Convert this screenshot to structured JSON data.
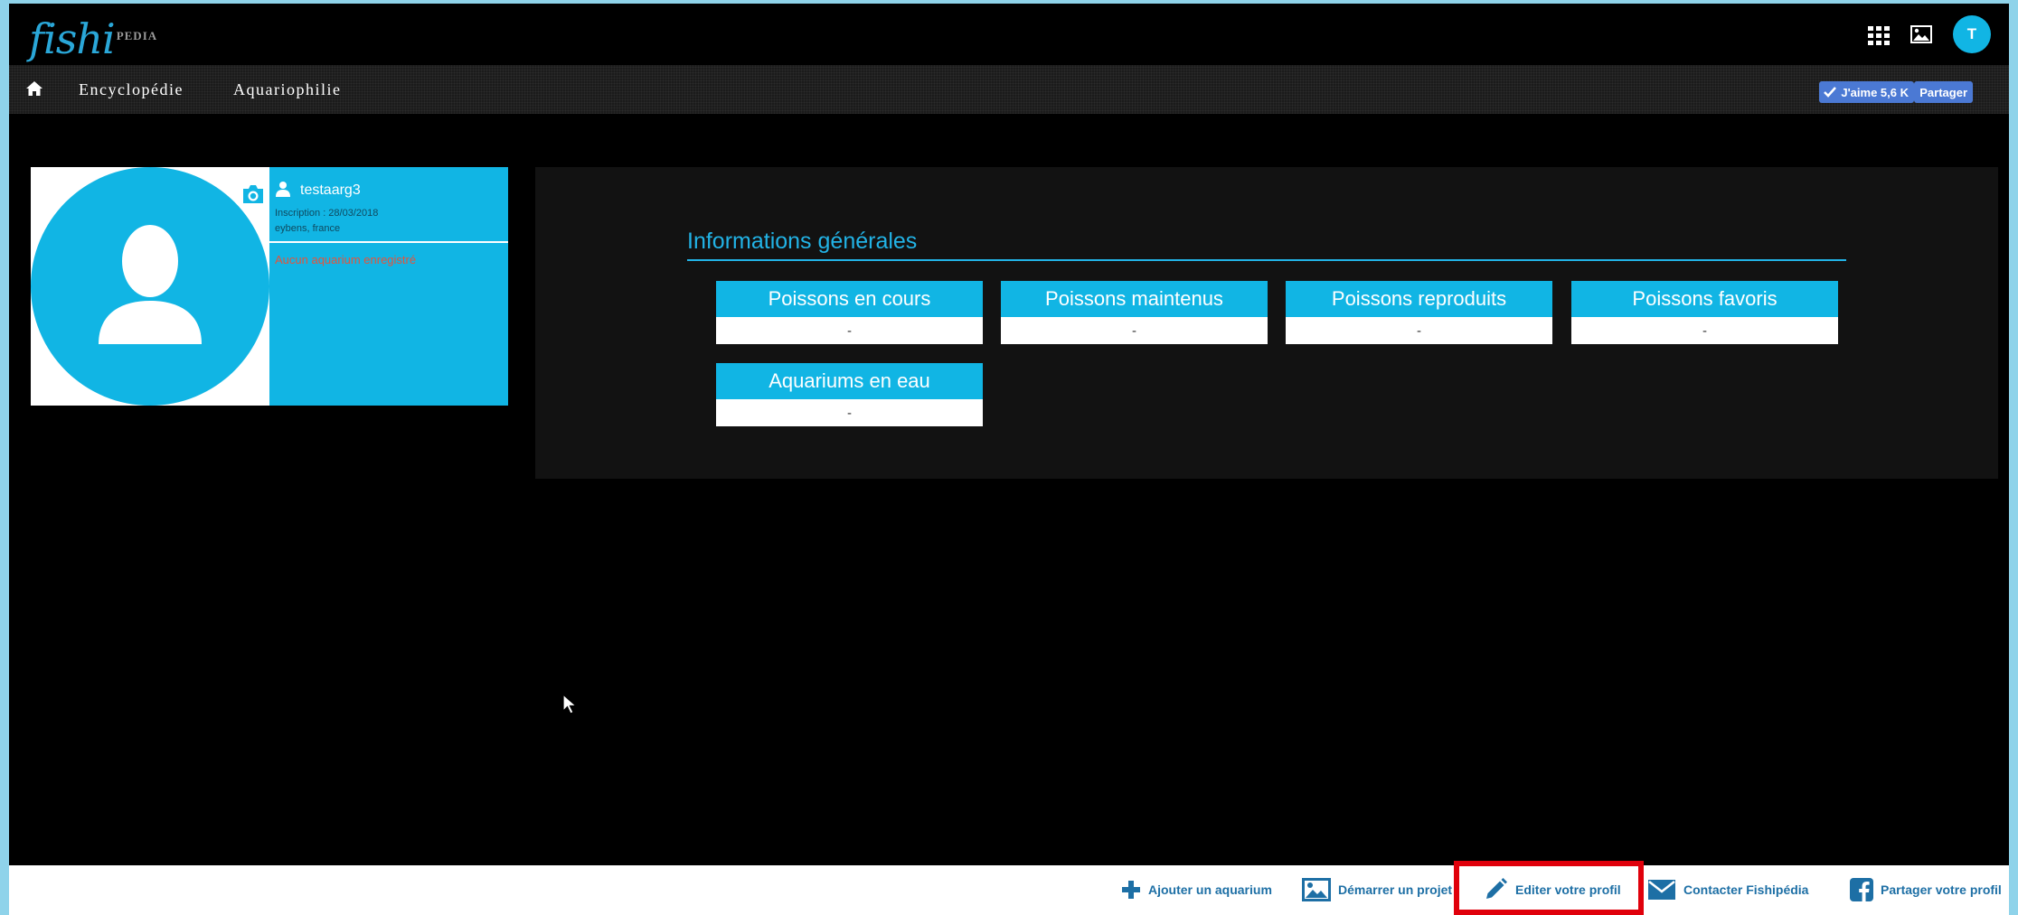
{
  "header": {
    "logo_script": "fishi",
    "logo_small": "PEDIA",
    "user_initial": "T"
  },
  "nav": {
    "items": [
      "Encyclopédie",
      "Aquariophilie"
    ],
    "like_label": "J'aime 5,6 K",
    "share_label": "Partager"
  },
  "profile": {
    "username": "testaarg3",
    "inscription": "Inscription : 28/03/2018",
    "location": "eybens, france",
    "no_aquarium": "Aucun aquarium enregistré"
  },
  "info": {
    "title": "Informations générales",
    "stats": [
      {
        "label": "Poissons en cours",
        "value": "-"
      },
      {
        "label": "Poissons maintenus",
        "value": "-"
      },
      {
        "label": "Poissons reproduits",
        "value": "-"
      },
      {
        "label": "Poissons favoris",
        "value": "-"
      },
      {
        "label": "Aquariums en eau",
        "value": "-"
      }
    ]
  },
  "footer": {
    "actions": [
      {
        "label": "Ajouter un aquarium",
        "icon": "plus-icon"
      },
      {
        "label": "Démarrer un projet",
        "icon": "image-icon"
      },
      {
        "label": "Editer votre profil",
        "icon": "pencil-icon"
      },
      {
        "label": "Contacter Fishipédia",
        "icon": "envelope-icon"
      },
      {
        "label": "Partager votre profil",
        "icon": "facebook-icon"
      }
    ]
  },
  "colors": {
    "accent": "#11b5e4",
    "highlight": "#e0000b",
    "link": "#1d6fa5",
    "warning_text": "#e5533a"
  }
}
